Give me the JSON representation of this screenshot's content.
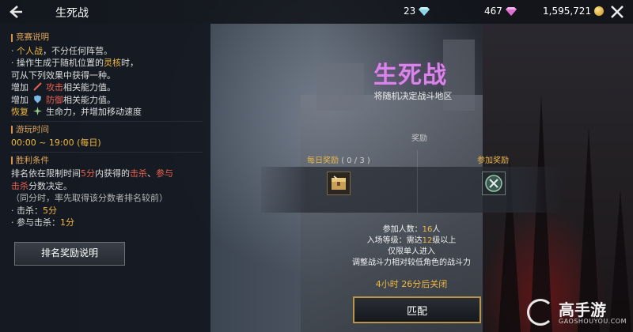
{
  "header": {
    "title": "生死战",
    "currency_diamond_blue": "23",
    "currency_diamond_pink": "467",
    "currency_gold": "1,595,721"
  },
  "rules": {
    "section1_title": "竞赛说明",
    "l1a": "· ",
    "l1b": "个人战",
    "l1c": "，不分任何阵营。",
    "l2a": "· 操作生成于随机位置的",
    "l2b": "灵核",
    "l2c": "时，",
    "l3": "可从下列效果中获得一种。",
    "l4a": "增加",
    "l4b": "攻击",
    "l4c": "相关能力值。",
    "l5a": "增加",
    "l5b": "防御",
    "l5c": "相关能力值。",
    "l6a": "恢复",
    "l6b": "生命力，并增加移动速度",
    "section2_title": "游玩时间",
    "time": "00:00 ~ 19:00 (每日)",
    "section3_title": "胜利条件",
    "v1a": "排名依在限制时间",
    "v1b": "5分",
    "v1c": "内获得的",
    "v1d": "击杀",
    "v1e": "、",
    "v1f": "参与",
    "v2a": "击杀",
    "v2b": "分数决定。",
    "v3": "（同分时，率先取得该分数者排名较前）",
    "v4a": "· 击杀：",
    "v4b": "5分",
    "v5a": "· 参与击杀：",
    "v5b": "1分",
    "rank_button": "排名奖励说明"
  },
  "main": {
    "title": "生死战",
    "subtitle": "将随机决定战斗地区",
    "reward_label": "奖励",
    "daily_reward": "每日奖励",
    "daily_count": "( 0 / 3 )",
    "join_reward": "参加奖励",
    "participants_a": "参加人数：",
    "participants_b": "16",
    "participants_c": "人",
    "level_a": "入场等级：需达",
    "level_b": "12",
    "level_c": "级以上",
    "solo": "仅限单人进入",
    "adjust": "调整战斗力相对较低角色的战斗力",
    "timer_a": "4",
    "timer_b": "小时 ",
    "timer_c": "26",
    "timer_d": "分后关闭",
    "match_button": "匹配"
  },
  "watermark": {
    "brand": "高手游",
    "site": "GAOSHOUYOU.COM"
  },
  "colors": {
    "accent_gold": "#f0b840",
    "title_purple": "#d884e8",
    "highlight_red": "#e86050"
  },
  "icons": {
    "back": "back-arrow-icon",
    "close": "close-icon",
    "diamond_blue": "diamond-icon",
    "diamond_pink": "pink-diamond-icon",
    "gold": "gold-coin-icon"
  }
}
